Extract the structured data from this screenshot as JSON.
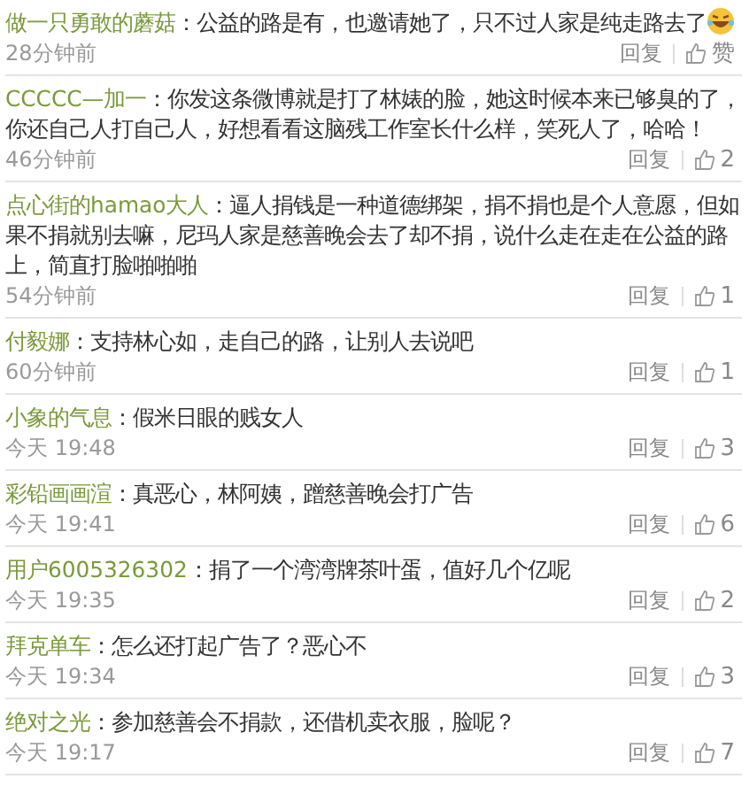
{
  "comments": [
    {
      "user": "做一只勇敢的蘑菇",
      "text": "：公益的路是有，也邀请她了，只不过人家是纯走路去了",
      "laughing_emoji": true,
      "time": "28分钟前",
      "reply": "回复",
      "likes": "赞"
    },
    {
      "user": "CCCCC—加一",
      "text": "：你发这条微博就是打了林婊的脸，她这时候本来已够臭的了，你还自己人打自己人，好想看看这脑残工作室长什么样，笑死人了，哈哈！",
      "time": "46分钟前",
      "reply": "回复",
      "likes": "2"
    },
    {
      "user": "点心街的hamao大人",
      "text": "：逼人捐钱是一种道德绑架，捐不捐也是个人意愿，但如果不捐就别去嘛，尼玛人家是慈善晚会去了却不捐，说什么走在走在公益的路上，简直打脸啪啪啪",
      "time": "54分钟前",
      "reply": "回复",
      "likes": "1"
    },
    {
      "user": "付毅娜",
      "text": "：支持林心如，走自己的路，让别人去说吧",
      "time": "60分钟前",
      "reply": "回复",
      "likes": "1"
    },
    {
      "user": "小象的气息",
      "text": "：假米日眼的贱女人",
      "time": "今天 19:48",
      "reply": "回复",
      "likes": "3"
    },
    {
      "user": "彩铅画画渲",
      "text": "：真恶心，林阿姨，蹭慈善晚会打广告",
      "time": "今天 19:41",
      "reply": "回复",
      "likes": "6"
    },
    {
      "user": "用户6005326302",
      "text": "：捐了一个湾湾牌茶叶蛋，值好几个亿呢",
      "time": "今天 19:35",
      "reply": "回复",
      "likes": "2"
    },
    {
      "user": "拜克单车",
      "text": "：怎么还打起广告了？恶心不",
      "time": "今天 19:34",
      "reply": "回复",
      "likes": "3"
    },
    {
      "user": "绝对之光",
      "text": "：参加慈善会不捐款，还借机卖衣服，脸呢？",
      "time": "今天 19:17",
      "reply": "回复",
      "likes": "7"
    }
  ]
}
